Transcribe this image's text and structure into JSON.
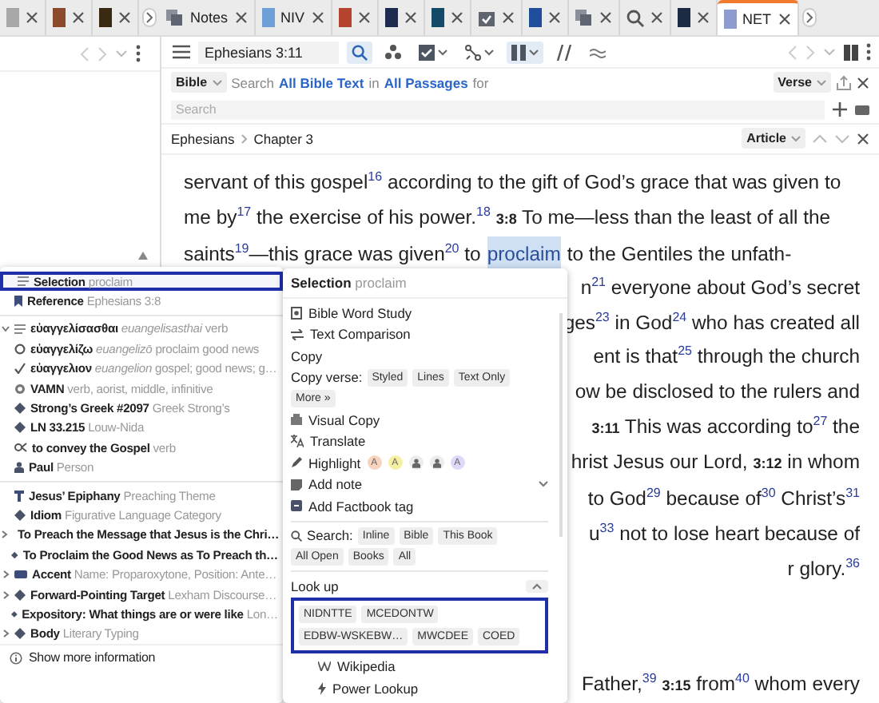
{
  "tabs": [
    {
      "kind": "book",
      "color": "#a8a8a8",
      "selected": false
    },
    {
      "kind": "book",
      "color": "#8b4a2b",
      "selected": false
    },
    {
      "kind": "book",
      "color": "#3b2a12",
      "selected": false
    },
    {
      "kind": "notes",
      "label": "Notes",
      "selected": false
    },
    {
      "kind": "book",
      "label": "NIV",
      "color": "#6f9fd8",
      "selected": false
    },
    {
      "kind": "book",
      "color": "#b5442e",
      "selected": false
    },
    {
      "kind": "book",
      "color": "#1d2b4f",
      "selected": false
    },
    {
      "kind": "book",
      "color": "#134a66",
      "selected": false
    },
    {
      "kind": "calendar",
      "selected": false
    },
    {
      "kind": "book",
      "color": "#1f4f9c",
      "selected": false
    },
    {
      "kind": "stack",
      "selected": false
    },
    {
      "kind": "search",
      "selected": false
    },
    {
      "kind": "book",
      "color": "#1c2a44",
      "selected": false
    },
    {
      "kind": "book",
      "label": "NET",
      "color": "#8c9bd0",
      "selected": true
    }
  ],
  "reader": {
    "reference": "Ephesians 3:11",
    "tools": [
      {
        "kind": "search",
        "active": true,
        "caret": false
      },
      {
        "kind": "dots",
        "active": false,
        "caret": false
      },
      {
        "kind": "checkbox",
        "active": false,
        "caret": true
      },
      {
        "kind": "route",
        "active": false,
        "caret": true
      },
      {
        "kind": "columns",
        "active": true,
        "caret": true
      },
      {
        "kind": "parallel",
        "active": false,
        "caret": false
      },
      {
        "kind": "approx",
        "active": false,
        "caret": false
      }
    ],
    "search_bar": {
      "scope": "Bible",
      "prefix": "Search",
      "range": "All Bible Text",
      "joiner": "in",
      "passages": "All Passages",
      "suffix": "for",
      "mode": "Verse",
      "placeholder": "Search"
    },
    "breadcrumb": [
      "Ephesians",
      "Chapter 3"
    ],
    "view": "Article",
    "lines": [
      [
        {
          "text": "servant of this gospel$^{16}$ according to the gift of God’s grace that was given to",
          "selected": false
        }
      ],
      [
        {
          "text": "me by$^{17}$ the exercise of his power.$^{18}$ **3:8** To me—less than the least of all the",
          "selected": false
        }
      ],
      [
        {
          "text": "saints$^{19}$—this grace was given$^{20}$ to",
          "selected": false
        },
        {
          "text": "proclaim",
          "selected": true
        },
        {
          "text": "to the Gentiles the unfath-",
          "selected": false
        }
      ]
    ],
    "partial_lines": [
      "n$^{21}$ everyone about God’s secret",
      "ges$^{23}$ in God$^{24}$ who has created all",
      "ent is that$^{25}$ through the church",
      "ow be disclosed to the rulers and",
      "**3:11** This was according to$^{27}$ the",
      "hrist Jesus our Lord, **3:12** in whom",
      "to God$^{29}$ because of$^{30}$ Christ’s$^{31}$",
      "u$^{33}$ not to lose heart because of",
      "r glory.$^{36}$"
    ],
    "last_line": "Father,$^{39}$ **3:15** from$^{40}$ whom every"
  },
  "info_panel": {
    "groups": [
      [
        {
          "kind": "selection",
          "label": "Selection",
          "detail": "proclaim",
          "selected": true
        },
        {
          "kind": "reference",
          "label": "Reference",
          "detail": "Ephesians 3:8",
          "selected": false
        }
      ],
      [
        {
          "kind": "lemma",
          "label": "εὐαγγελίσασθαι",
          "translit": "euangelisasthai",
          "detail": "verb",
          "expanded": true,
          "selected": false
        },
        {
          "kind": "root",
          "label": "εὐαγγελίζω",
          "translit": "euangelizō",
          "detail": "proclaim good news",
          "selected": false
        },
        {
          "kind": "check",
          "label": "εὐαγγελιον",
          "translit": "euangelion",
          "detail": "gospel; good news; g…",
          "selected": false
        },
        {
          "kind": "morph",
          "label": "VAMN",
          "detail": "verb, aorist, middle, infinitive",
          "selected": false
        },
        {
          "kind": "diamond",
          "label": "Strong’s Greek #2097",
          "detail": "Greek Strong’s",
          "selected": false
        },
        {
          "kind": "diamond",
          "label": "LN 33.215",
          "detail": "Louw-Nida",
          "selected": false
        },
        {
          "kind": "sense",
          "label": "to convey the Gospel",
          "detail": "verb",
          "selected": false
        },
        {
          "kind": "person",
          "label": "Paul",
          "detail": "Person",
          "selected": false
        }
      ],
      [
        {
          "kind": "theme",
          "label": "Jesus’ Epiphany",
          "detail": "Preaching Theme",
          "selected": false
        },
        {
          "kind": "diamond",
          "label": "Idiom",
          "detail": "Figurative Language Category",
          "selected": false
        },
        {
          "kind": "diamond",
          "label": "To Preach the Message that Jesus is the Chri…",
          "expanded": false,
          "selected": false
        },
        {
          "kind": "diamond",
          "label": "To Proclaim the Good News as To Preach th…",
          "selected": false
        },
        {
          "kind": "tag",
          "label": "Accent",
          "detail": "Name: Proparoxytone, Position: Ante…",
          "expanded": false,
          "selected": false
        },
        {
          "kind": "diamond",
          "label": "Forward-Pointing Target",
          "detail": "Lexham Discourse…",
          "expanded": false,
          "selected": false
        },
        {
          "kind": "diamond",
          "label": "Expository: What things are or were like",
          "detail": "Lon…",
          "selected": false
        },
        {
          "kind": "diamond",
          "label": "Body",
          "detail": "Literary Typing",
          "expanded": false,
          "selected": false
        }
      ]
    ],
    "show_more": "Show more information"
  },
  "context_menu": {
    "title": "Selection",
    "subtitle": "proclaim",
    "entries": [
      {
        "kind": "study",
        "label": "Bible Word Study"
      },
      {
        "kind": "compare",
        "label": "Text Comparison"
      },
      {
        "kind": "heading",
        "label": "Copy"
      },
      {
        "kind": "chips",
        "label": "Copy verse:",
        "chips": [
          "Styled",
          "Lines",
          "Text Only",
          "More »"
        ]
      },
      {
        "kind": "visualcopy",
        "label": "Visual Copy"
      },
      {
        "kind": "translate",
        "label": "Translate"
      },
      {
        "kind": "highlight",
        "label": "Highlight",
        "swatches": [
          {
            "kind": "letter",
            "label": "A",
            "color": "#f8d3bf"
          },
          {
            "kind": "letter",
            "label": "A",
            "color": "#f6f0a4"
          },
          {
            "kind": "person",
            "color": "#ececec"
          },
          {
            "kind": "person",
            "color": "#ececec"
          },
          {
            "kind": "letter",
            "label": "A",
            "color": "#e0d8f7"
          }
        ]
      },
      {
        "kind": "note",
        "label": "Add note",
        "expanded": false
      },
      {
        "kind": "tag",
        "label": "Add Factbook tag"
      },
      {
        "kind": "divider"
      },
      {
        "kind": "search",
        "label": "Search:",
        "chips": [
          "Inline",
          "Bible",
          "This Book",
          "All Open",
          "Books",
          "All"
        ]
      },
      {
        "kind": "divider"
      },
      {
        "kind": "lookup",
        "label": "Look up",
        "expanded": true
      },
      {
        "kind": "resources",
        "outlined": true,
        "chips": [
          "NIDNTTE",
          "MCEDONTW",
          "EDBW-WSKEBW…",
          "MWCDEE",
          "COED"
        ]
      },
      {
        "kind": "wiki",
        "label": "Wikipedia"
      },
      {
        "kind": "power",
        "label": "Power Lookup"
      }
    ]
  }
}
